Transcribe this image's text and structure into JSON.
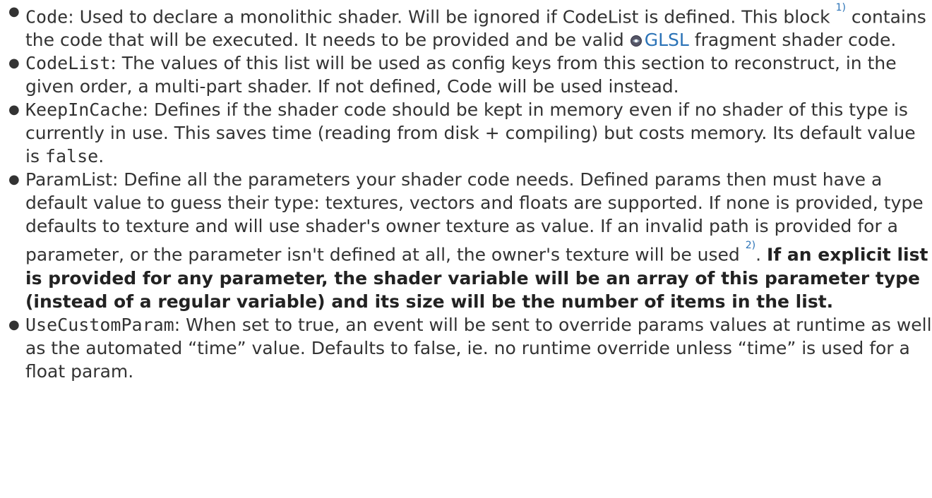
{
  "items": [
    {
      "key": "Code",
      "text1": ": Used to declare a monolithic shader. Will be ignored if CodeList is defined. This block ",
      "footnote": "1)",
      "text2": " contains the code that will be executed. It needs to be provided and be valid ",
      "link_label": "GLSL",
      "link_icon": "external-link-icon",
      "text3": " fragment shader code."
    },
    {
      "key": "CodeList",
      "text1": ": The values of this list will be used as config keys from this section to reconstruct, in the given order, a multi-part shader. If not defined, Code will be used instead."
    },
    {
      "key": "KeepInCache",
      "text1": ": Defines if the shader code should be kept in memory even if no shader of this type is currently in use. This saves time (reading from disk + compiling) but costs memory. Its default value is ",
      "value": "false",
      "text2": "."
    },
    {
      "key": "ParamList",
      "text1": ": Define all the parameters your shader code needs. Defined params then must have a default value to guess their type: textures, vectors and floats are supported. If none is provided, type defaults to texture and will use shader's owner texture as value. If an invalid path is provided for a parameter, or the parameter isn't defined at all, the owner's texture will be used ",
      "footnote": "2)",
      "text2": ". ",
      "bold": "If an explicit list is provided for any parameter, the shader variable will be an array of this parameter type (instead of a regular variable) and its size will be the number of items in the list."
    },
    {
      "key": "UseCustomParam",
      "text1": ": When set to true, an event will be sent to override params values at runtime as well as the automated “time” value. Defaults to false, ie. no runtime override unless “time” is used for a float param."
    }
  ],
  "colors": {
    "text": "#333333",
    "link": "#2b73b7"
  }
}
